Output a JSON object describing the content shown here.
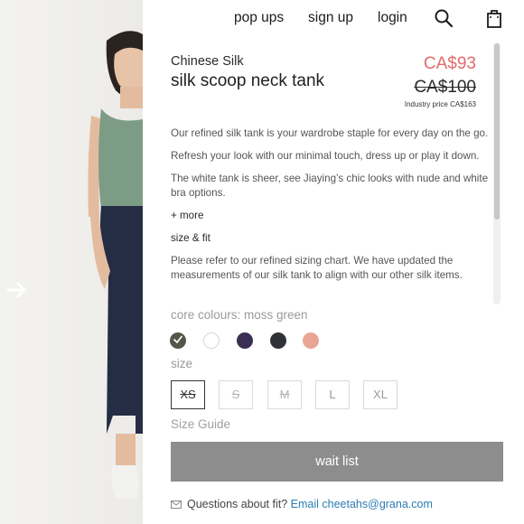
{
  "nav": {
    "popups": "pop ups",
    "signup": "sign up",
    "login": "login",
    "search_icon": "search-icon",
    "bag_icon": "shopping-bag-icon"
  },
  "product": {
    "brand": "Chinese Silk",
    "title": "silk scoop neck tank",
    "price": "CA$93",
    "original_price": "CA$100",
    "industry_price": "Industry price CA$163",
    "price_color": "#e26a6a"
  },
  "description": {
    "p1": "Our refined silk tank is your wardrobe staple for every day on the go.",
    "p2": "Refresh your look with our minimal touch, dress up or play it down.",
    "p3": "The white tank is sheer, see Jiaying’s chic looks with nude and white bra options.",
    "more": "+ more",
    "size_fit_heading": "size & fit",
    "p4": "Please refer to our refined sizing chart. We have updated the measurements of our silk tank to align with our other silk items."
  },
  "colours": {
    "label": "core colours: moss green",
    "swatches": [
      "#55564a",
      "#ffffff",
      "#3a2e52",
      "#2f3236",
      "#e9a593"
    ],
    "selected_index": 0
  },
  "sizes": {
    "label": "size",
    "options": [
      "XS",
      "S",
      "M",
      "L",
      "XL"
    ],
    "selected": "XS",
    "unavailable": [
      "XS",
      "S",
      "M"
    ]
  },
  "size_guide": "Size Guide",
  "waitlist_label": "wait list",
  "fit_question": {
    "text": "Questions about fit?",
    "link": "Email cheetahs@grana.com"
  }
}
